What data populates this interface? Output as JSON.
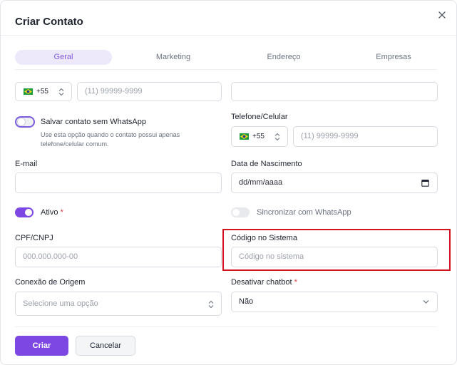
{
  "dialog": {
    "title": "Criar Contato"
  },
  "tabs": [
    {
      "label": "Geral",
      "active": true
    },
    {
      "label": "Marketing",
      "active": false
    },
    {
      "label": "Endereço",
      "active": false
    },
    {
      "label": "Empresas",
      "active": false
    }
  ],
  "phone_main": {
    "country_code": "+55",
    "placeholder": "(11) 99999-9999"
  },
  "name_field": {
    "value": ""
  },
  "whatsapp_toggle": {
    "label": "Salvar contato sem WhatsApp",
    "hint_line1": "Use esta opção quando o contato possui apenas",
    "hint_line2": "telefone/celular comum.",
    "on": false
  },
  "telefone": {
    "label": "Telefone/Celular",
    "country_code": "+55",
    "placeholder": "(11) 99999-9999"
  },
  "email": {
    "label": "E-mail",
    "value": ""
  },
  "nascimento": {
    "label": "Data de Nascimento",
    "placeholder": "dd/mm/aaaa"
  },
  "ativo": {
    "label": "Ativo",
    "required_mark": "*",
    "on": true
  },
  "sync_whatsapp": {
    "label": "Sincronizar com WhatsApp",
    "on": false
  },
  "cpf": {
    "label": "CPF/CNPJ",
    "placeholder": "000.000.000-00"
  },
  "codigo": {
    "label": "Código no Sistema",
    "placeholder": "Código no sistema"
  },
  "conexao": {
    "label": "Conexão de Origem",
    "placeholder": "Selecione uma opção"
  },
  "chatbot": {
    "label": "Desativar chatbot",
    "required_mark": "*",
    "value": "Não"
  },
  "actions": {
    "create_label": "Criar",
    "cancel_label": "Cancelar"
  },
  "colors": {
    "accent": "#7c47e3",
    "highlight_box": "#d4141c"
  },
  "icons": {
    "close": "close-icon",
    "flag": "brazil-flag-icon",
    "select_arrows": "updown-chevron-icon",
    "calendar": "calendar-icon",
    "dropdown": "chevron-down-icon"
  }
}
